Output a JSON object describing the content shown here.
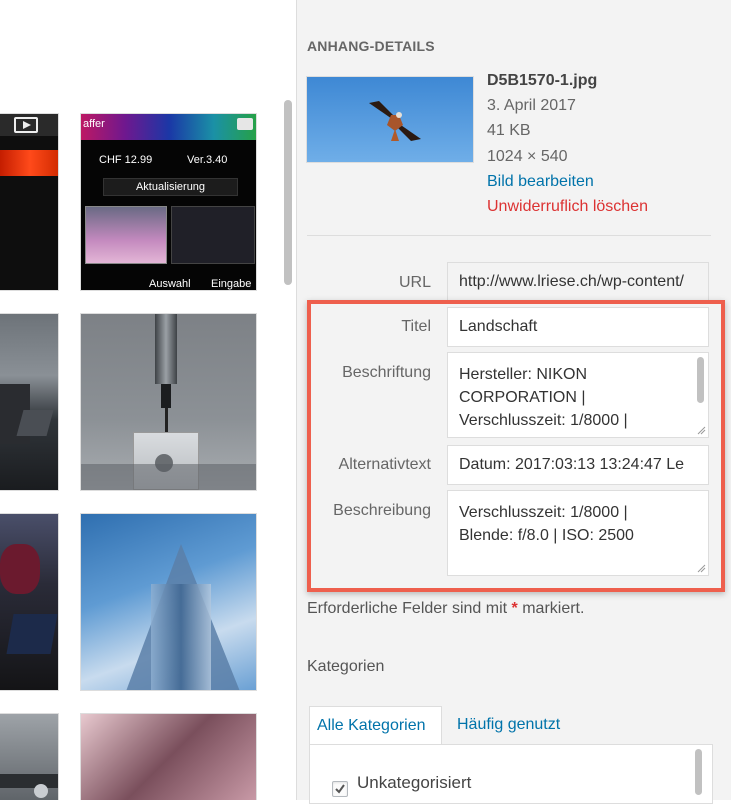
{
  "sidebar": {
    "header": "ANHANG-DETAILS",
    "file": {
      "filename": "D5B1570-1.jpg",
      "date": "3. April 2017",
      "size": "41 KB",
      "dimensions": "1024 × 540",
      "edit_link": "Bild bearbeiten",
      "delete_link": "Unwiderruflich löschen"
    },
    "fields": {
      "url_label": "URL",
      "url_value": "http://www.lriese.ch/wp-content/",
      "title_label": "Titel",
      "title_value": "Landschaft",
      "caption_label": "Beschriftung",
      "caption_value": "Hersteller: NIKON CORPORATION | Verschlusszeit: 1/8000 |",
      "alt_label": "Alternativtext",
      "alt_value": "Datum: 2017:03:13 13:24:47 Le",
      "desc_label": "Beschreibung",
      "desc_value": "Verschlusszeit: 1/8000 | Blende: f/8.0 | ISO: 2500"
    },
    "required_note": {
      "before": "Erforderliche Felder sind mit",
      "star": "*",
      "after": "markiert."
    },
    "categories": {
      "heading": "Kategorien",
      "tab_all": "Alle Kategorien",
      "tab_frequent": "Häufig genutzt",
      "item_label": "Unkategorisiert",
      "item_checked": true
    }
  },
  "grid": {
    "thumb2": {
      "title_frag": "affer",
      "price": "CHF 12.99",
      "version": "Ver.3.40",
      "update_label": "Aktualisierung",
      "select_label": "Auswahl",
      "enter_label": "Eingabe"
    }
  },
  "colors": {
    "link": "#0073aa",
    "danger": "#dc3232",
    "highlight": "#ee5f4d",
    "required_star": "#dc3232"
  }
}
